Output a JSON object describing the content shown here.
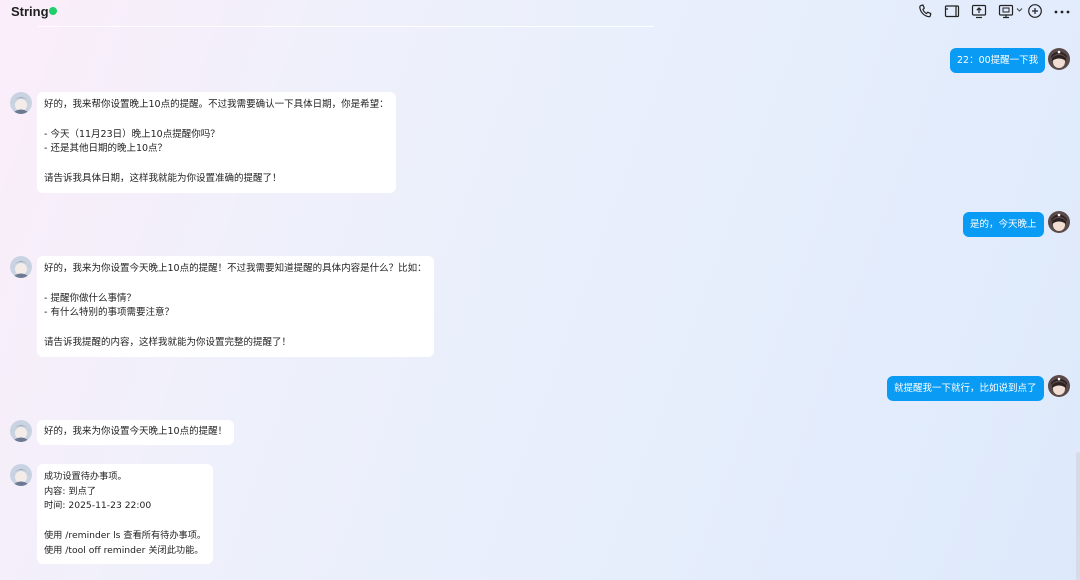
{
  "header": {
    "title": "String",
    "status_color": "#1fd06a",
    "icons": [
      "phone-icon",
      "video-icon",
      "screen-share-icon",
      "remote-control-icon",
      "chevron-down-icon",
      "add-icon",
      "more-icon"
    ]
  },
  "messages": [
    {
      "role": "user",
      "text": "22：00提醒一下我"
    },
    {
      "role": "bot",
      "lines": [
        "好的，我来帮你设置晚上10点的提醒。不过我需要确认一下具体日期，你是希望：",
        "",
        "- 今天（11月23日）晚上10点提醒你吗？",
        "- 还是其他日期的晚上10点？",
        "",
        "请告诉我具体日期，这样我就能为你设置准确的提醒了！"
      ]
    },
    {
      "role": "user",
      "text": "是的，今天晚上"
    },
    {
      "role": "bot",
      "lines": [
        "好的，我来为你设置今天晚上10点的提醒！不过我需要知道提醒的具体内容是什么？比如：",
        "",
        "- 提醒你做什么事情？",
        "- 有什么特别的事项需要注意？",
        "",
        "请告诉我提醒的内容，这样我就能为你设置完整的提醒了！"
      ]
    },
    {
      "role": "user",
      "text": "就提醒我一下就行，比如说到点了"
    },
    {
      "role": "bot",
      "lines": [
        "好的，我来为你设置今天晚上10点的提醒！"
      ]
    },
    {
      "role": "bot",
      "lines": [
        "成功设置待办事项。",
        "内容: 到点了",
        "时间: 2025-11-23 22:00",
        "",
        "使用 /reminder ls 查看所有待办事项。",
        "使用 /tool off reminder 关闭此功能。"
      ]
    }
  ],
  "colors": {
    "user_bubble": "#0a9bf5",
    "bot_bubble": "#ffffff"
  }
}
